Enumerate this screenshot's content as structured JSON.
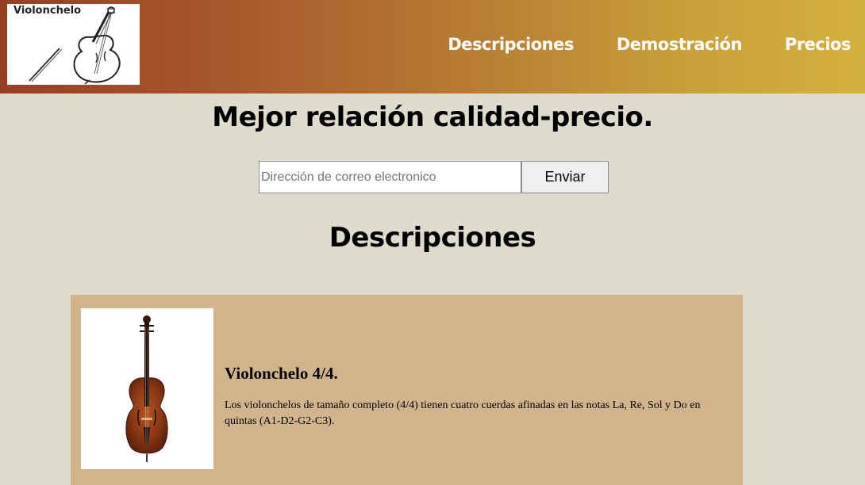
{
  "header": {
    "logo_text": "Violonchelo",
    "nav": [
      {
        "label": "Descripciones"
      },
      {
        "label": "Demostración"
      },
      {
        "label": "Precios"
      }
    ]
  },
  "hero": {
    "headline": "Mejor relación calidad-precio.",
    "email_placeholder": "Dirección de correo electronico",
    "submit_label": "Enviar"
  },
  "descriptions": {
    "heading": "Descripciones",
    "items": [
      {
        "title": "Violonchelo 4/4.",
        "text": "Los violonchelos de tamaño completo (4/4) tienen cuatro cuerdas afinadas en las notas La, Re, Sol y Do en quintas (A1-D2-G2-C3)."
      }
    ]
  },
  "colors": {
    "header_gradient_start": "#983e24",
    "header_gradient_end": "#d4b03e",
    "page_background": "#dfdbcd",
    "card_background": "#d1b48b"
  }
}
